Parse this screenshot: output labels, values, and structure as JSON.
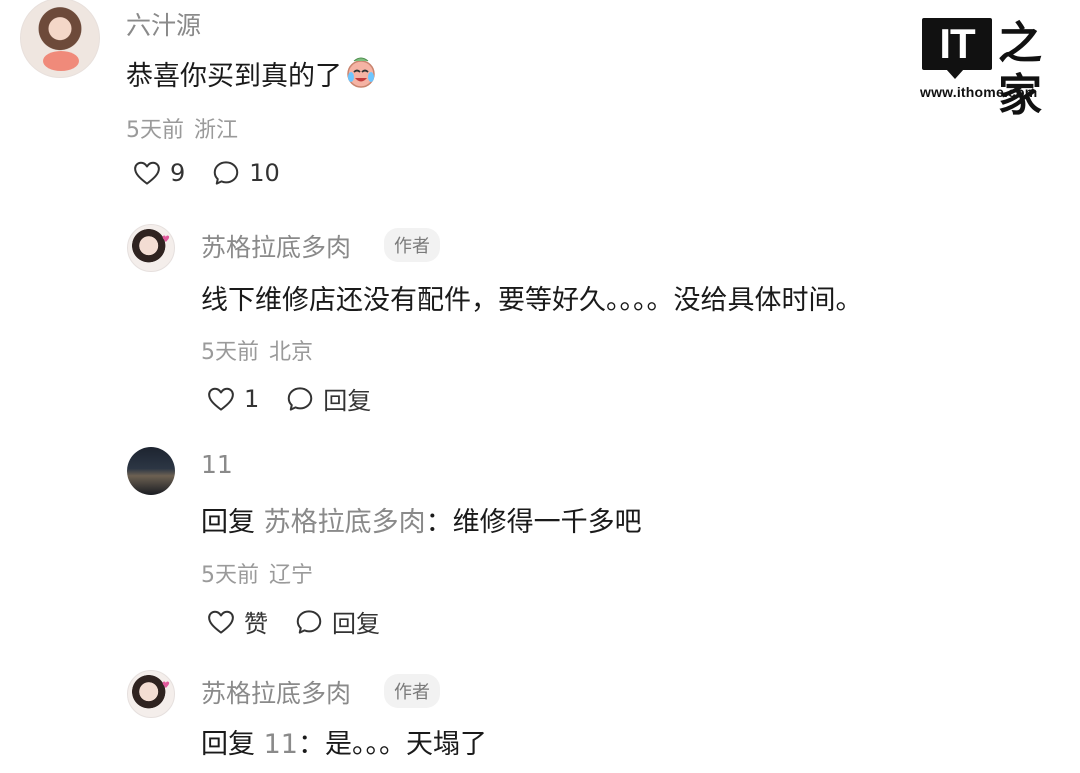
{
  "watermark": {
    "logo": "IT",
    "logo_zh": "之家",
    "url": "www.ithome.com"
  },
  "comments": [
    {
      "user": "六汁源",
      "text": "恭喜你买到真的了",
      "emoji": "crying-laughing-face",
      "time": "5天前",
      "location": "浙江",
      "likes": "9",
      "replies": "10"
    },
    {
      "user": "苏格拉底多肉",
      "tag": "作者",
      "text": "线下维修店还没有配件，要等好久。。。。没给具体时间。",
      "time": "5天前",
      "location": "北京",
      "likes": "1",
      "reply_label": "回复"
    },
    {
      "user": "11",
      "reply_prefix": "回复",
      "reply_to": "苏格拉底多肉",
      "text": "：维修得一千多吧",
      "time": "5天前",
      "location": "辽宁",
      "like_label": "赞",
      "reply_label": "回复"
    },
    {
      "user": "苏格拉底多肉",
      "tag": "作者",
      "reply_prefix": "回复",
      "reply_to": "11",
      "text": "：是。。。天塌了"
    }
  ],
  "icons": {
    "like": "heart-outline-icon",
    "comment": "chat-bubble-icon"
  }
}
